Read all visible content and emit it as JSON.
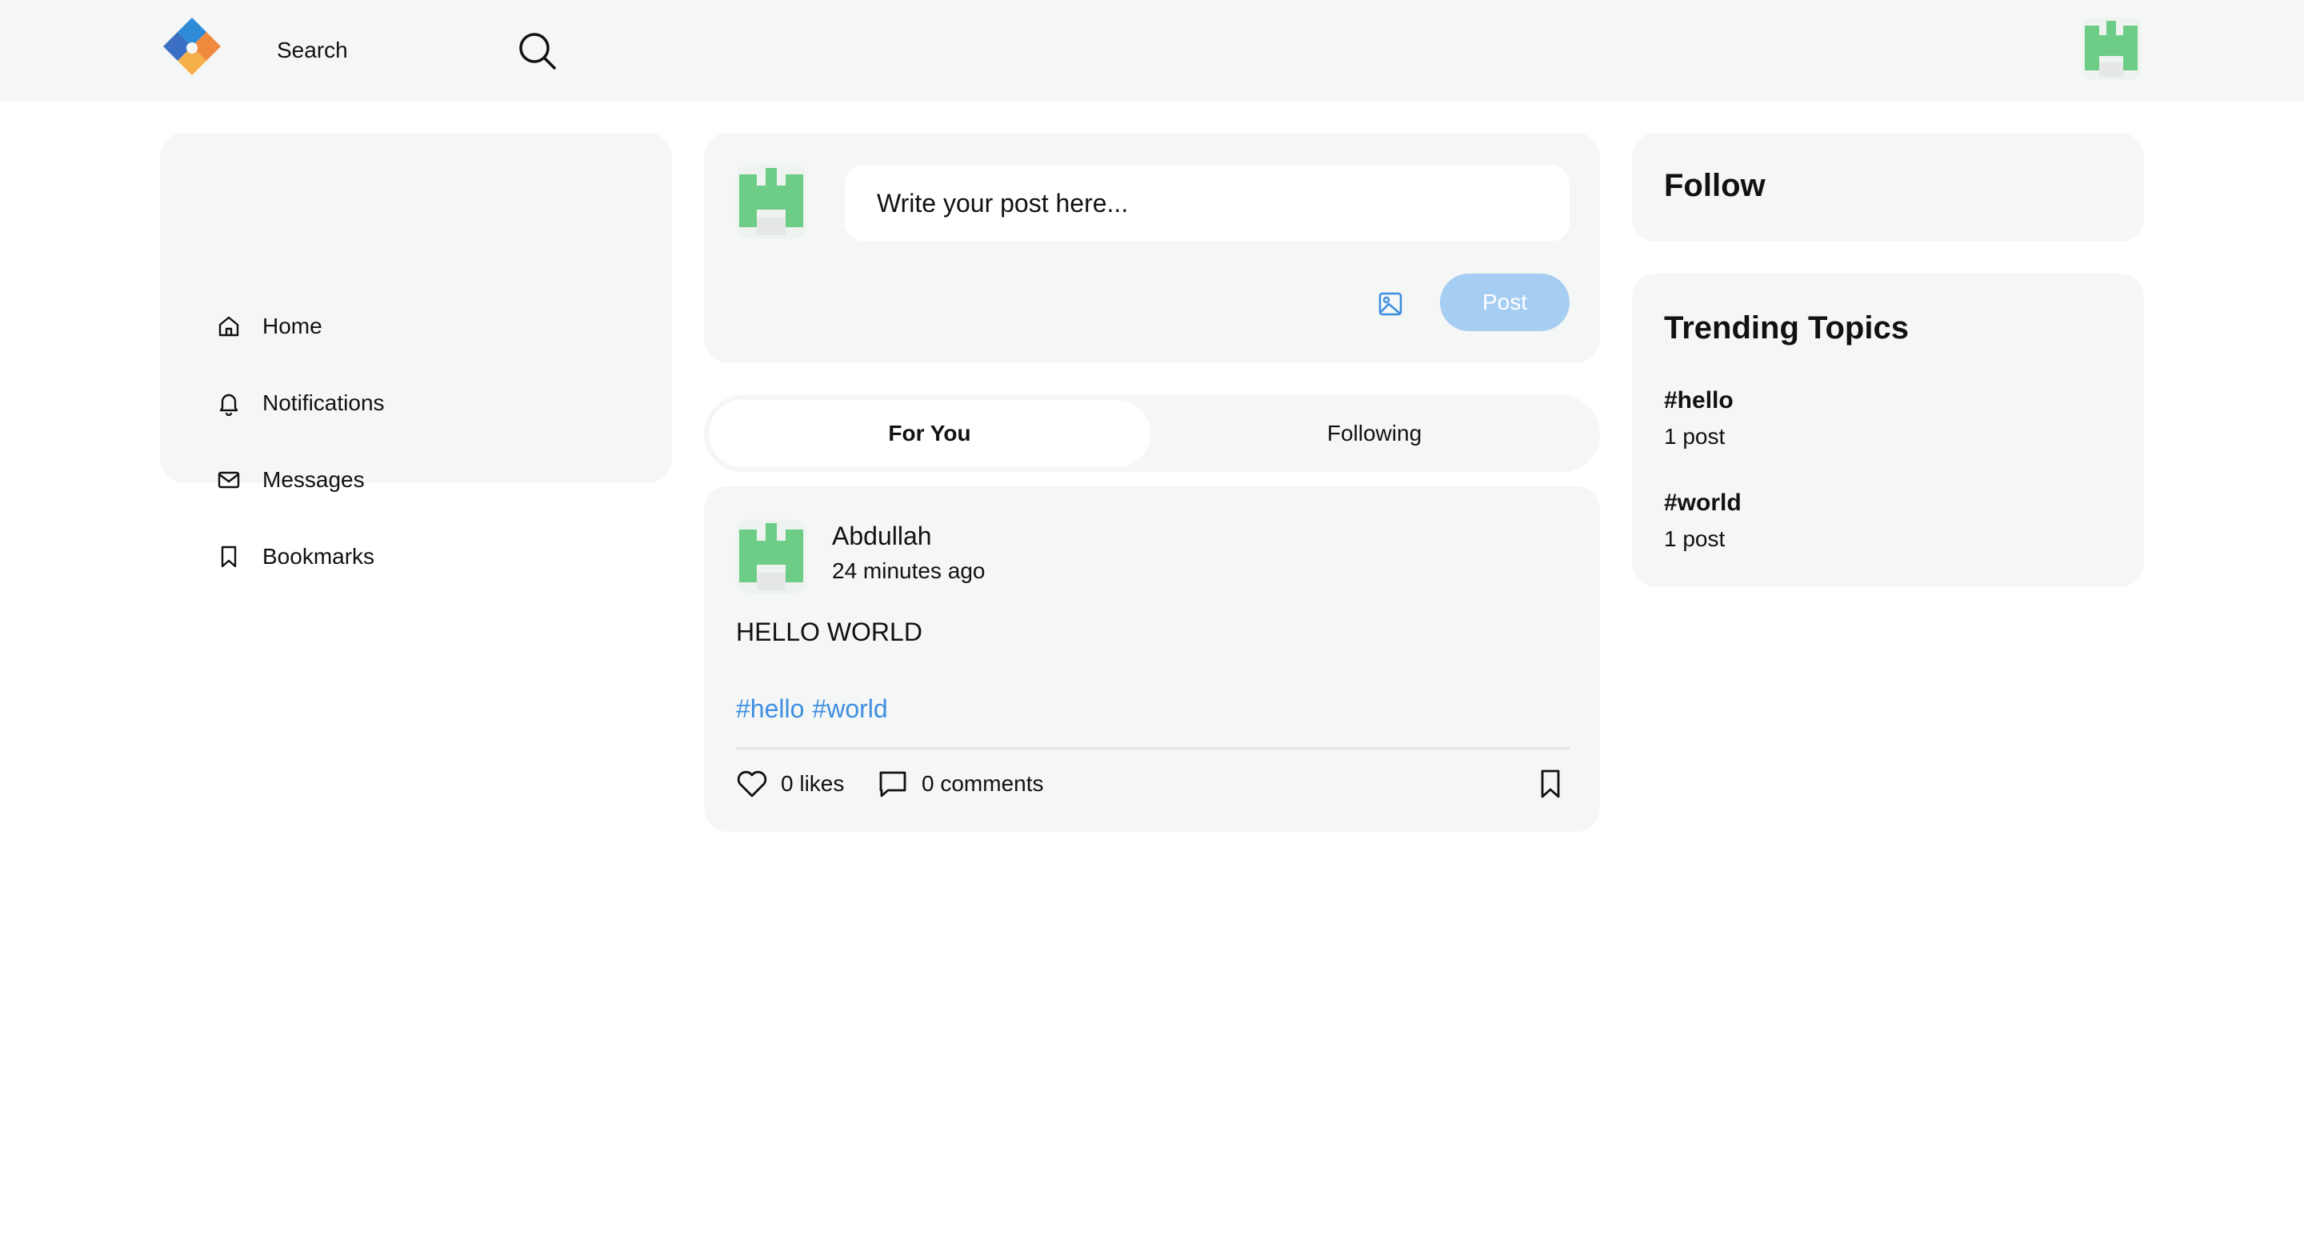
{
  "header": {
    "search_placeholder": "Search"
  },
  "sidebar": {
    "items": [
      {
        "label": "Home",
        "icon": "home-icon"
      },
      {
        "label": "Notifications",
        "icon": "bell-icon"
      },
      {
        "label": "Messages",
        "icon": "mail-icon"
      },
      {
        "label": "Bookmarks",
        "icon": "bookmark-icon"
      }
    ]
  },
  "composer": {
    "placeholder": "Write your post here...",
    "post_label": "Post"
  },
  "tabs": [
    {
      "label": "For You",
      "active": true
    },
    {
      "label": "Following",
      "active": false
    }
  ],
  "post": {
    "author": "Abdullah",
    "time": "24 minutes ago",
    "content": "HELLO WORLD",
    "tags": [
      "#hello",
      "#world"
    ],
    "likes": "0 likes",
    "comments": "0 comments"
  },
  "right": {
    "follow_title": "Follow",
    "trending_title": "Trending Topics",
    "topics": [
      {
        "name": "#hello",
        "count": "1 post"
      },
      {
        "name": "#world",
        "count": "1 post"
      }
    ]
  },
  "colors": {
    "panel_bg": "#f5f6f6",
    "accent": "#3d8fe0",
    "post_button": "#a6cdf2",
    "avatar_green": "#6dcc86"
  }
}
